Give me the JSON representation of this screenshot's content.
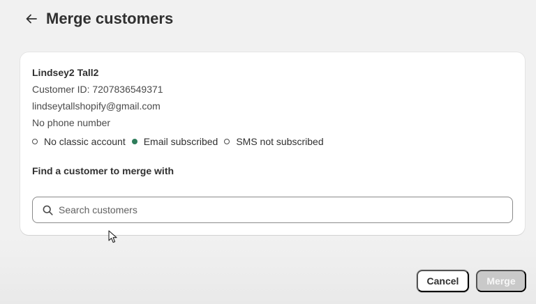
{
  "header": {
    "title": "Merge customers",
    "back_icon": "arrow-left-icon"
  },
  "customer": {
    "name": "Lindsey2 Tall2",
    "id_line": "Customer ID: 7207836549371",
    "email": "lindseytallshopify@gmail.com",
    "phone": "No phone number",
    "statuses": [
      {
        "label": "No classic account",
        "indicator": "empty"
      },
      {
        "label": "Email subscribed",
        "indicator": "filled",
        "color": "#2f7d5b"
      },
      {
        "label": "SMS not subscribed",
        "indicator": "empty"
      }
    ]
  },
  "merge": {
    "label": "Find a customer to merge with",
    "search_placeholder": "Search customers",
    "search_value": "",
    "search_icon": "search-icon"
  },
  "actions": {
    "cancel_label": "Cancel",
    "merge_label": "Merge",
    "merge_disabled": true
  }
}
